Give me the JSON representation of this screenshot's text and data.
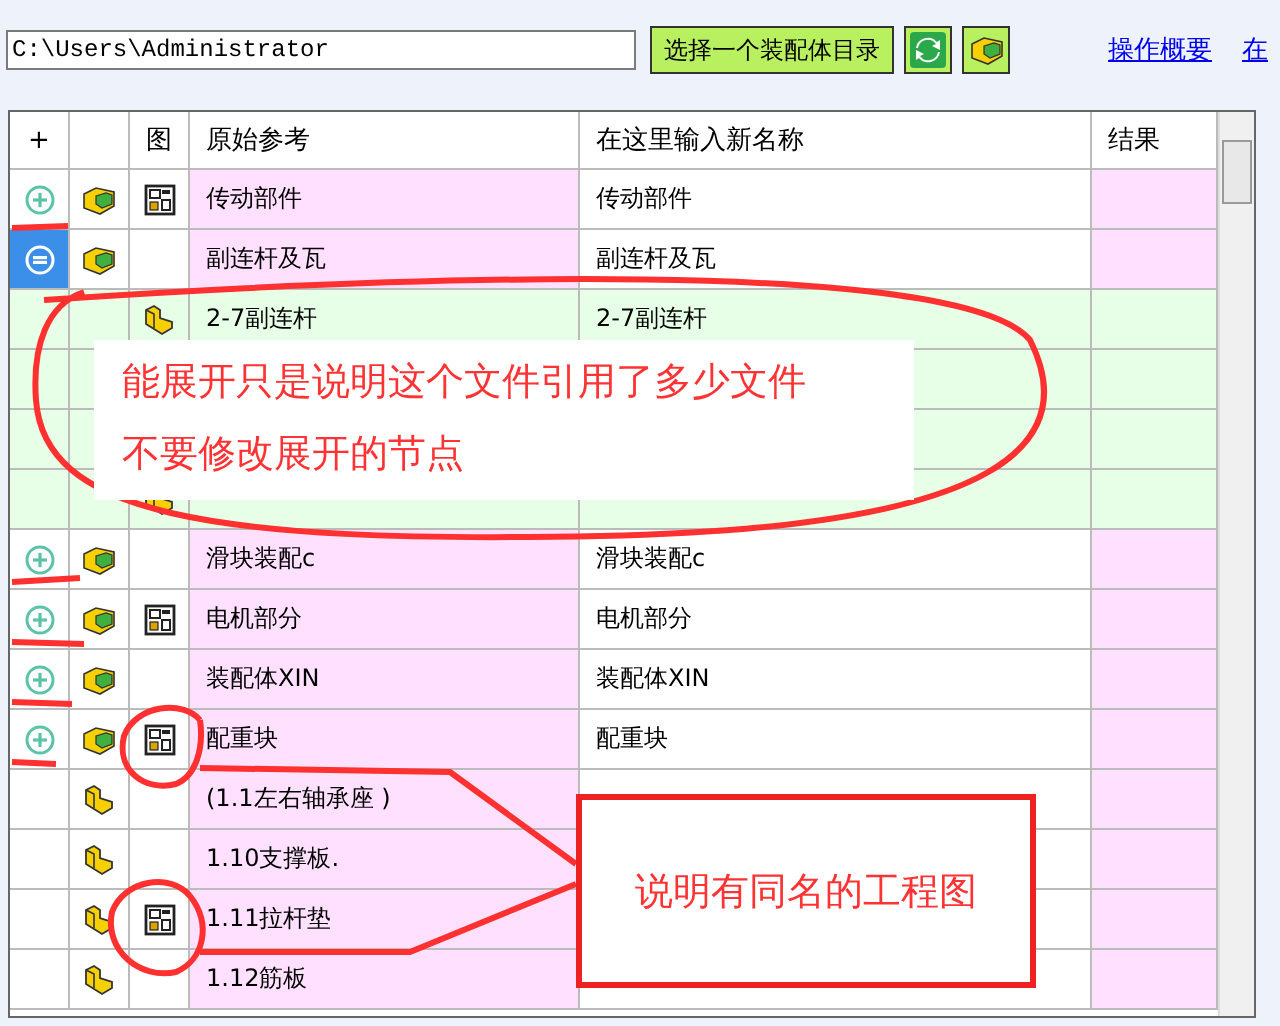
{
  "path_field": {
    "value": "C:\\Users\\Administrator"
  },
  "toolbar": {
    "select_button": "选择一个装配体目录",
    "links": [
      "操作概要",
      "在"
    ]
  },
  "table": {
    "columns": [
      "+",
      "",
      "图",
      "原始参考",
      "在这里输入新名称",
      "结果"
    ],
    "rows": [
      {
        "kind": "assembly",
        "expandable": true,
        "expanded": false,
        "selected": false,
        "drawing": true,
        "original": "传动部件",
        "new_name": "传动部件"
      },
      {
        "kind": "assembly",
        "expandable": true,
        "expanded": true,
        "selected": true,
        "drawing": false,
        "original": "副连杆及瓦",
        "new_name": "副连杆及瓦",
        "children": [
          {
            "kind": "part",
            "selected": false,
            "original": "2-7副连杆",
            "new_name": "2-7副连杆"
          },
          {
            "selected": false
          },
          {
            "selected": false
          },
          {
            "kind": "part",
            "selected": false
          }
        ]
      },
      {
        "kind": "assembly",
        "expandable": true,
        "expanded": false,
        "selected": false,
        "drawing": false,
        "original": "滑块装配c",
        "new_name": "滑块装配c"
      },
      {
        "kind": "assembly",
        "expandable": true,
        "expanded": false,
        "selected": false,
        "drawing": true,
        "original": "电机部分",
        "new_name": "电机部分"
      },
      {
        "kind": "assembly",
        "expandable": true,
        "expanded": false,
        "selected": false,
        "drawing": false,
        "original": "装配体XIN",
        "new_name": "装配体XIN"
      },
      {
        "kind": "assembly",
        "expandable": true,
        "expanded": false,
        "selected": false,
        "drawing": true,
        "original": "配重块",
        "new_name": "配重块"
      },
      {
        "kind": "part",
        "expandable": false,
        "selected": false,
        "drawing": false,
        "original": "(1.1左右轴承座 )"
      },
      {
        "kind": "part",
        "expandable": false,
        "selected": false,
        "drawing": false,
        "original": "1.10支撑板."
      },
      {
        "kind": "part",
        "expandable": false,
        "selected": false,
        "drawing": true,
        "original": "1.11拉杆垫"
      },
      {
        "kind": "part",
        "expandable": false,
        "selected": false,
        "drawing": false,
        "original": "1.12筋板"
      }
    ]
  },
  "annotations": [
    {
      "text": "能展开只是说明这个文件引用了多少文件",
      "text_2": "不要修改展开的节点"
    },
    {
      "text": "说明有同名的工程图"
    }
  ]
}
